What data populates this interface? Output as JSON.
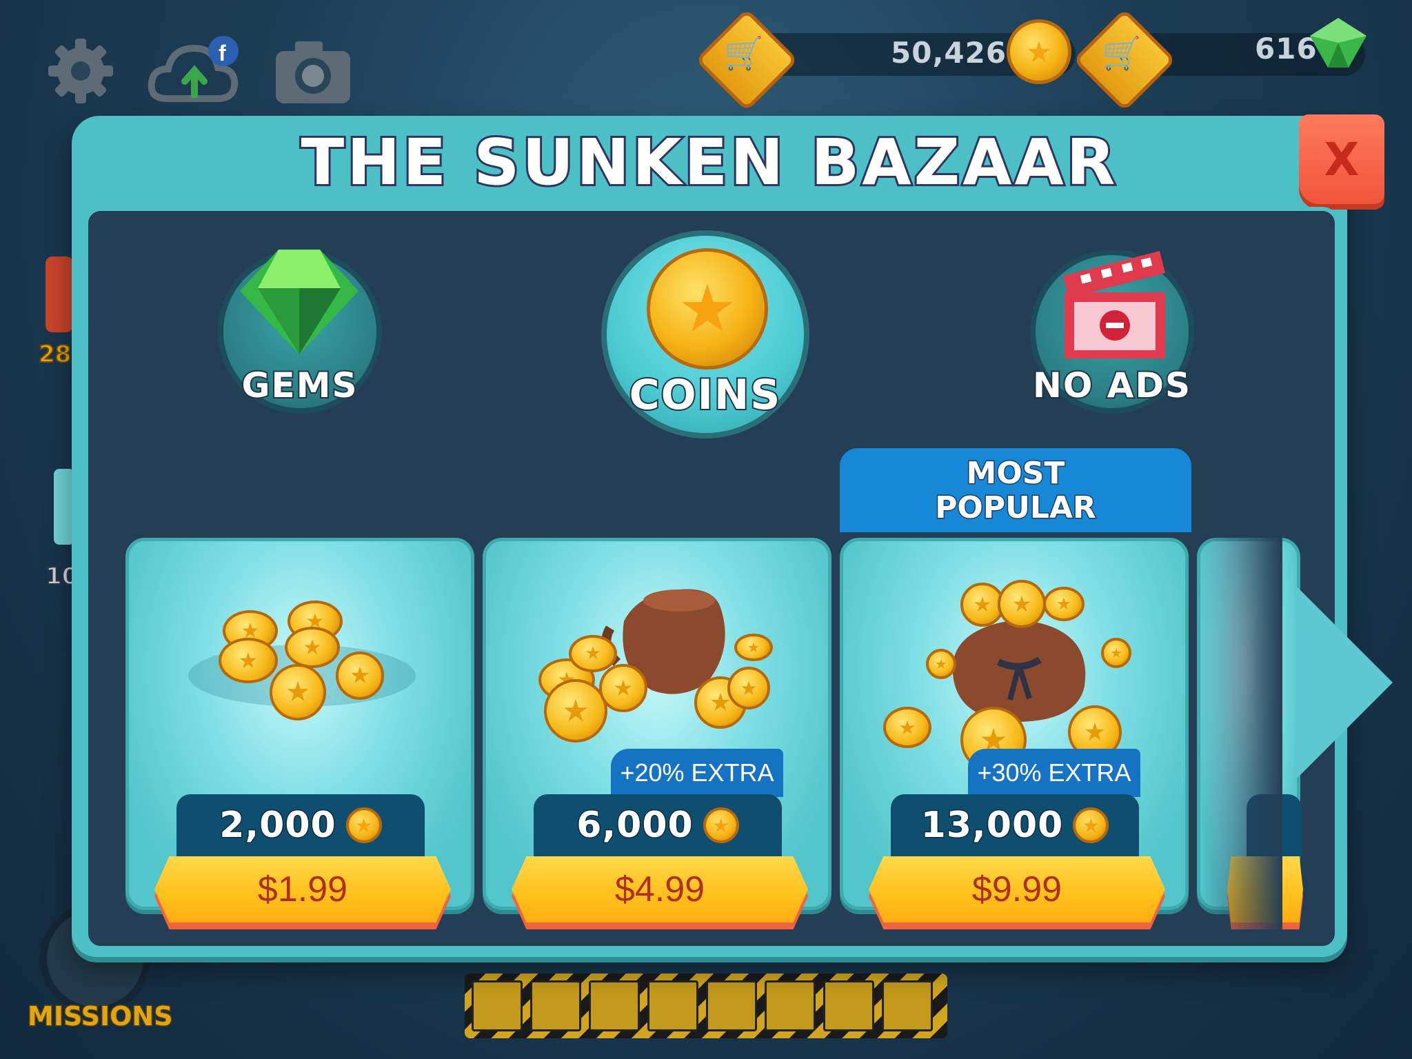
{
  "hud": {
    "icons": [
      "gear-icon",
      "cloud-upload-facebook-icon",
      "camera-icon"
    ],
    "coins": "50,426",
    "gems": "616"
  },
  "modal": {
    "title": "THE SUNKEN BAZAAR",
    "close_label": "X",
    "categories": [
      {
        "label": "GEMS",
        "icon": "gem-icon"
      },
      {
        "label": "COINS",
        "icon": "coin-icon"
      },
      {
        "label": "NO ADS",
        "icon": "clapperboard-icon"
      }
    ],
    "badge": {
      "line1": "MOST",
      "line2": "POPULAR"
    },
    "packs": [
      {
        "amount": "2,000",
        "price": "$1.99",
        "extra": ""
      },
      {
        "amount": "6,000",
        "price": "$4.99",
        "extra": "+20% EXTRA"
      },
      {
        "amount": "13,000",
        "price": "$9.99",
        "extra": "+30% EXTRA"
      }
    ]
  },
  "background": {
    "missions_label": "MISSIONS",
    "side_numbers": [
      "28",
      "10"
    ]
  },
  "colors": {
    "panel": "#4cc0c4",
    "inner": "#243e55",
    "price_button": "#ffc21f",
    "price_text": "#b0301f",
    "close_button": "#f0553b",
    "badge": "#1788d6"
  }
}
